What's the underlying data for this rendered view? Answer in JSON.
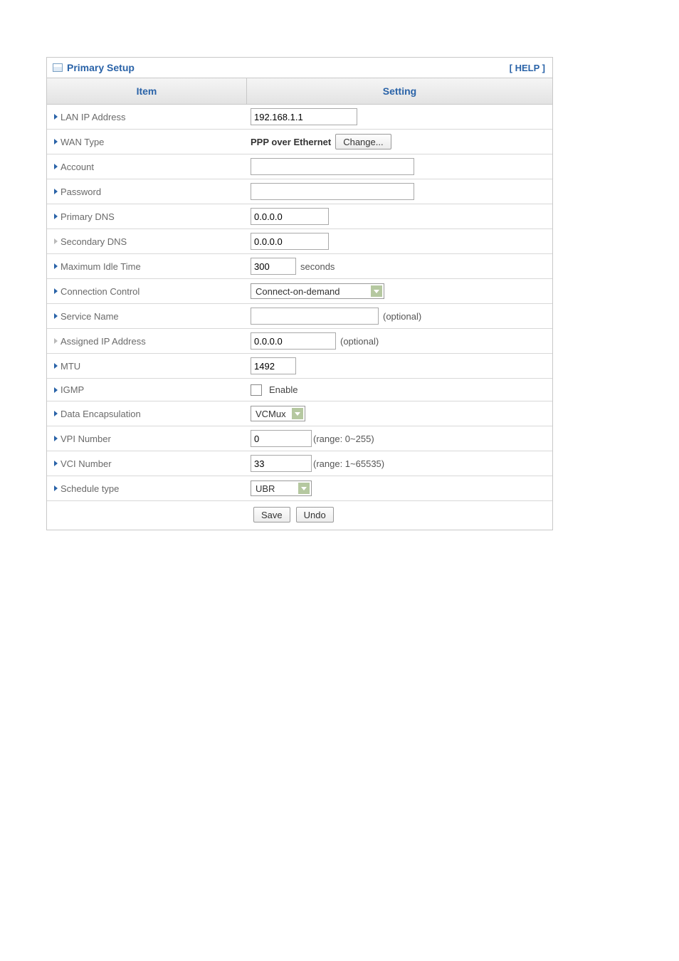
{
  "title": "Primary Setup",
  "help_label": "[ HELP ]",
  "headers": {
    "item": "Item",
    "setting": "Setting"
  },
  "rows": {
    "lan_ip": {
      "label": "LAN IP Address",
      "value": "192.168.1.1"
    },
    "wan_type": {
      "label": "WAN Type",
      "value": "PPP over Ethernet",
      "button": "Change..."
    },
    "account": {
      "label": "Account",
      "value": ""
    },
    "password": {
      "label": "Password",
      "value": ""
    },
    "pdns": {
      "label": "Primary DNS",
      "value": "0.0.0.0"
    },
    "sdns": {
      "label": "Secondary DNS",
      "value": "0.0.0.0"
    },
    "idle": {
      "label": "Maximum Idle Time",
      "value": "300",
      "unit": "seconds"
    },
    "conn": {
      "label": "Connection Control",
      "selected": "Connect-on-demand"
    },
    "servname": {
      "label": "Service Name",
      "value": "",
      "hint": "(optional)"
    },
    "assigned": {
      "label": "Assigned IP Address",
      "value": "0.0.0.0",
      "hint": "(optional)"
    },
    "mtu": {
      "label": "MTU",
      "value": "1492"
    },
    "igmp": {
      "label": "IGMP",
      "checkbox_label": "Enable"
    },
    "encap": {
      "label": "Data Encapsulation",
      "selected": "VCMux"
    },
    "vpi": {
      "label": "VPI Number",
      "value": "0",
      "hint": "(range: 0~255)"
    },
    "vci": {
      "label": "VCI Number",
      "value": "33",
      "hint": "(range: 1~65535)"
    },
    "sched": {
      "label": "Schedule type",
      "selected": "UBR"
    }
  },
  "buttons": {
    "save": "Save",
    "undo": "Undo"
  }
}
